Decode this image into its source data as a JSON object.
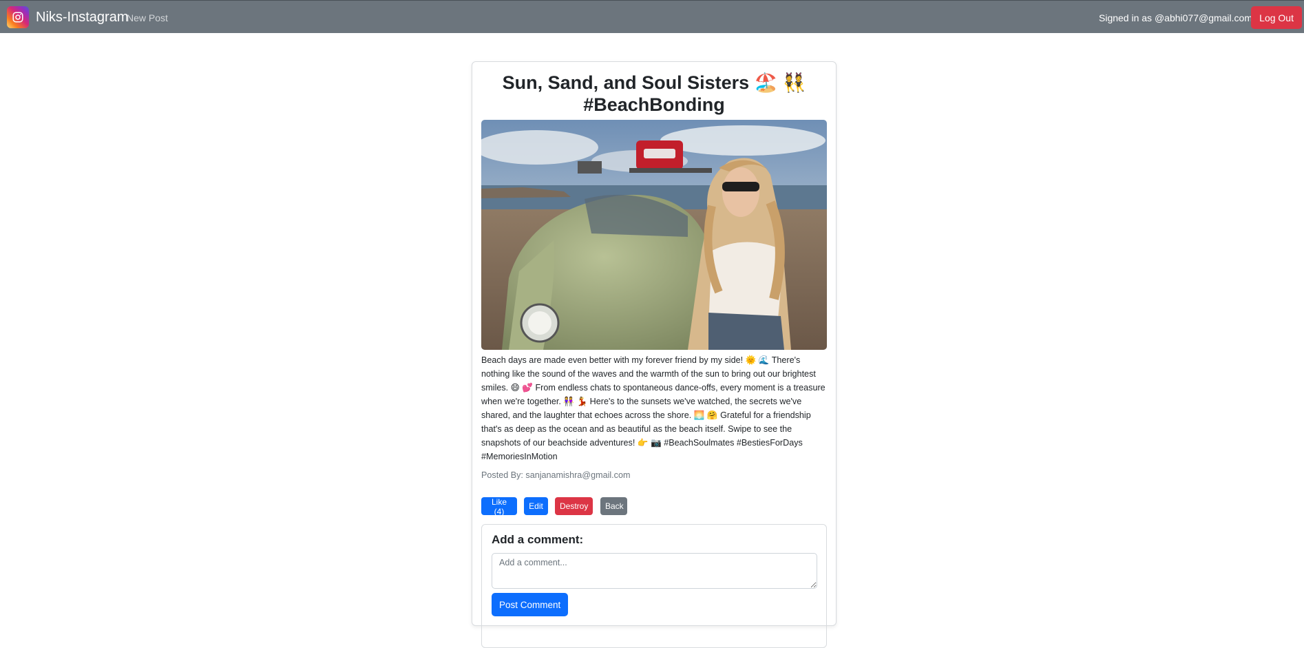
{
  "navbar": {
    "brand": "Niks-Instagram",
    "new_post": "New Post",
    "signed_in": "Signed in as @abhi077@gmail.com",
    "logout": "Log Out",
    "logo_icon": "instagram-icon",
    "bg_color": "#6c757d"
  },
  "post": {
    "title": "Sun, Sand, and Soul Sisters 🏖️ 👯 #BeachBonding",
    "image_alt": "Woman in sunglasses sitting on a green vintage Volkswagen Beetle with a red Coca-Cola cooler on the roof rack at the beach",
    "caption": "Beach days are made even better with my forever friend by my side! 🌞 🌊 There's nothing like the sound of the waves and the warmth of the sun to bring out our brightest smiles. 😄 💕 From endless chats to spontaneous dance-offs, every moment is a treasure when we're together. 👭 💃 Here's to the sunsets we've watched, the secrets we've shared, and the laughter that echoes across the shore. 🌅 🤗 Grateful for a friendship that's as deep as the ocean and as beautiful as the beach itself. Swipe to see the snapshots of our beachside adventures! 👉 📷 #BeachSoulmates #BestiesForDays #MemoriesInMotion",
    "posted_by": "Posted By: sanjanamishra@gmail.com"
  },
  "actions": {
    "like": "Like (4)",
    "edit": "Edit",
    "destroy": "Destroy",
    "back": "Back"
  },
  "comment": {
    "heading": "Add a comment:",
    "placeholder": "Add a comment...",
    "submit": "Post Comment"
  }
}
